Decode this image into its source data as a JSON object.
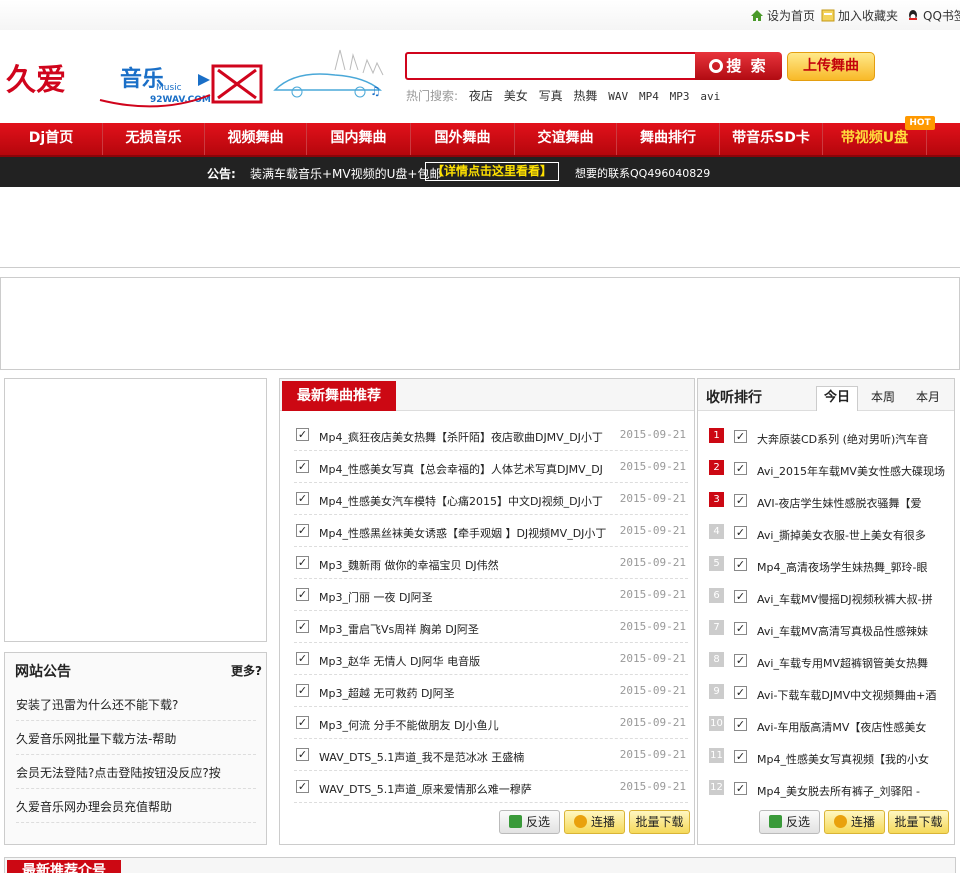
{
  "top_links": {
    "home": "设为首页",
    "favorite": "加入收藏夹",
    "qq": "QQ书签"
  },
  "header": {
    "logo_text": "久爱音乐网",
    "logo_sub": "Music",
    "logo_domain": "92WAV.COM",
    "search_button": "搜 索",
    "upload_button": "上传舞曲",
    "hot_label": "热门搜索:",
    "hot_keywords": [
      "夜店",
      "美女",
      "写真",
      "热舞",
      "WAV",
      "MP4",
      "MP3",
      "avi"
    ]
  },
  "nav": {
    "items": [
      "Dj首页",
      "无损音乐",
      "视频舞曲",
      "国内舞曲",
      "国外舞曲",
      "交谊舞曲",
      "舞曲排行",
      "带音乐SD卡",
      "带视频U盘"
    ],
    "hot_badge": "HOT"
  },
  "notice": {
    "title": "公告:",
    "text": "装满车载音乐+MV视频的U盘+包邮",
    "link": "【详情点击这里看看】",
    "contact": "想要的联系QQ496040829"
  },
  "board": {
    "title": "网站公告",
    "more": "更多?",
    "items": [
      "安装了迅雷为什么还不能下载?",
      "久爱音乐网批量下载方法-帮助",
      "会员无法登陆?点击登陆按钮没反应?按",
      "久爱音乐网办理会员充值帮助"
    ]
  },
  "latest": {
    "title": "最新舞曲推荐",
    "songs": [
      {
        "name": "Mp4_疯狂夜店美女热舞【杀阡陌】夜店歌曲DJMV_DJ小丁",
        "date": "2015-09-21"
      },
      {
        "name": "Mp4_性感美女写真【总会幸福的】人体艺术写真DJMV_DJ",
        "date": "2015-09-21"
      },
      {
        "name": "Mp4_性感美女汽车模特【心痛2015】中文DJ视频_DJ小丁",
        "date": "2015-09-21"
      },
      {
        "name": "Mp4_性感黑丝袜美女诱惑【牵手观姻 】DJ视频MV_DJ小丁",
        "date": "2015-09-21"
      },
      {
        "name": "Mp3_魏新雨 做你的幸福宝贝 DJ伟然",
        "date": "2015-09-21"
      },
      {
        "name": "Mp3_门丽 一夜 DJ阿圣",
        "date": "2015-09-21"
      },
      {
        "name": "Mp3_雷启飞Vs周祥 胸弟 DJ阿圣",
        "date": "2015-09-21"
      },
      {
        "name": "Mp3_赵华 无情人 DJ阿华 电音版",
        "date": "2015-09-21"
      },
      {
        "name": "Mp3_超越 无可救药 DJ阿圣",
        "date": "2015-09-21"
      },
      {
        "name": "Mp3_何流 分手不能做朋友 DJ小鱼儿",
        "date": "2015-09-21"
      },
      {
        "name": "WAV_DTS_5.1声道_我不是范冰冰 王盛楠",
        "date": "2015-09-21"
      },
      {
        "name": "WAV_DTS_5.1声道_原来爱情那么难一穆萨",
        "date": "2015-09-21"
      }
    ],
    "btn_invert": "反选",
    "btn_play": "连播",
    "btn_download": "批量下载"
  },
  "rank": {
    "title": "收听排行",
    "tabs": [
      "今日",
      "本周",
      "本月"
    ],
    "items": [
      {
        "num": "1",
        "name": "大奔原装CD系列 (绝对男听)汽车音"
      },
      {
        "num": "2",
        "name": "Avi_2015年车载MV美女性感大碟现场"
      },
      {
        "num": "3",
        "name": "AVI-夜店学生妹性感脱衣骚舞【爱"
      },
      {
        "num": "4",
        "name": "Avi_撕掉美女衣服-世上美女有很多"
      },
      {
        "num": "5",
        "name": "Mp4_高清夜场学生妹热舞_郭玲-眼"
      },
      {
        "num": "6",
        "name": "Avi_车载MV慢摇DJ视频秋裤大叔-拼"
      },
      {
        "num": "7",
        "name": "Avi_车载MV高清写真极品性感辣妹"
      },
      {
        "num": "8",
        "name": "Avi_车载专用MV超裤钢管美女热舞"
      },
      {
        "num": "9",
        "name": "Avi-下载车载DJMV中文视频舞曲+酒"
      },
      {
        "num": "10",
        "name": "Avi-车用版高清MV【夜店性感美女"
      },
      {
        "num": "11",
        "name": "Mp4_性感美女写真视频【我的小女"
      },
      {
        "num": "12",
        "name": "Mp4_美女脱去所有裤子_刘驿阳 -"
      }
    ],
    "btn_invert": "反选",
    "btn_play": "连播",
    "btn_download": "批量下载"
  },
  "footer": {
    "title": "最新推荐介号"
  },
  "colors": {
    "brand_red": "#cc0813",
    "nav_red": "#e2111b",
    "gold": "#ffdc3c"
  }
}
